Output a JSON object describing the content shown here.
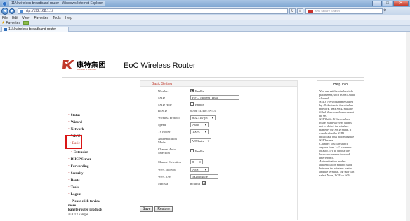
{
  "window": {
    "title": "11N wireless broadband router - Windows Internet Explorer",
    "address": "http://192.168.1.1/",
    "search_placeholder": "AVG Secure Search",
    "tab_title": "11N wireless broadband router"
  },
  "menu": [
    "File",
    "Edit",
    "View",
    "Favorites",
    "Tools",
    "Help"
  ],
  "favorites": {
    "label": "Favorites"
  },
  "header": {
    "brand_cn": "康特集团",
    "brand_en": "KANGTE GROUP",
    "product": "EoC Wireless Router"
  },
  "nav": {
    "status": "Status",
    "wizard": "Wizard",
    "network": "Network",
    "wlan": "WLAN",
    "basic": "Basic",
    "extension": "Extension",
    "dhcp": "DHCP Server",
    "forwarding": "Forwarding",
    "security": "Security",
    "route": "Route",
    "tools": "Tools",
    "logout": "Logout",
    "promo1": "---Please click to view",
    "promo2": "more",
    "promo3": "kangte router products",
    "copyright": "©2013 kangte"
  },
  "form": {
    "section_title": "Basic Setting",
    "wireless_label": "Wireless",
    "wireless_value": "Enable",
    "ssid_label": "SSID",
    "ssid_value": "HFC_Modem_Trial",
    "ssid_hide_label": "SSID Hide",
    "ssid_hide_value": "Enable",
    "bssid_label": "BSSID",
    "bssid_value": "00:0F:1E:B0:3A:43",
    "protocol_label": "Wireless Protocol",
    "protocol_value": "802.11b/g/n",
    "speed_label": "Speed",
    "speed_value": "Auto",
    "txpower_label": "Tx Power",
    "txpower_value": "100%",
    "auth_label1": "Authentication",
    "auth_label2": "Mode",
    "auth_value": "WPAmix",
    "channel_auto_label1": "Channel Auto",
    "channel_auto_label2": "Selection",
    "channel_auto_value": "Enable",
    "channel_label": "Channel Selection",
    "channel_value": "8",
    "encrypt_label": "WPA Encrypt",
    "encrypt_value": "AES",
    "key_label": "WPA Key",
    "key_value": "5a2b3c4d5e",
    "mac_label": "Mac sta",
    "mac_value": "no limit"
  },
  "buttons": {
    "save": "Save",
    "restore": "Restore"
  },
  "help": {
    "title": "Help Info",
    "lines": [
      "You can set the wireless info",
      "parameters, such as SSID and",
      "channel.",
      "SSID: Network name shared",
      "by all devices in the wireless",
      "network. Max SSID must be",
      "filled, the second one can not",
      "be set.",
      "SSID hide: If the wireless",
      "router want wireless clients",
      "not to detect the wireless",
      "name by the SSID name, it",
      "can disable the SSID",
      "broadcast, thus hiddening the",
      "SSID name.",
      "Channel: you can select",
      "anyone from 1-13 channels",
      "or auto. Try to choose the",
      "less use channels to avoid",
      "interference.",
      "Authentication modes:",
      "authentication method used",
      "between the wireless router",
      "and the terminal, the user can",
      "select None, WEP or WPA."
    ]
  },
  "colors": {
    "accent": "#b01d1d",
    "highlight": "#d91616",
    "chrome": "#c3d5ea"
  }
}
